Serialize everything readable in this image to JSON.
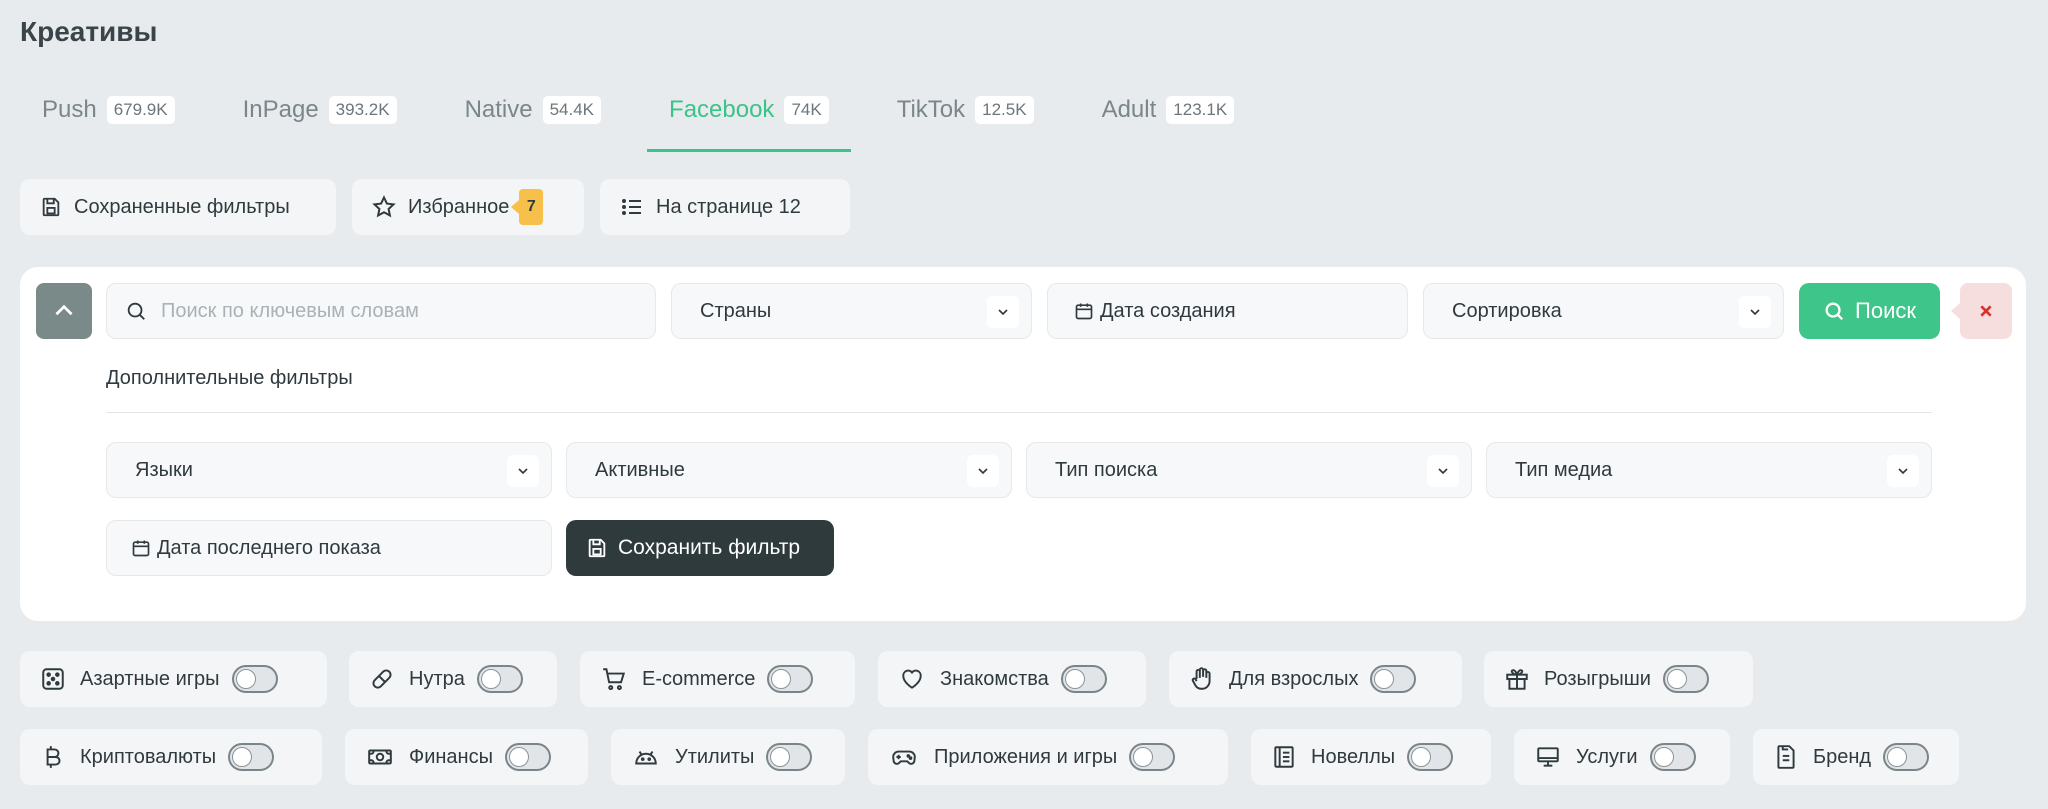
{
  "page": {
    "title": "Креативы"
  },
  "tabs": [
    {
      "label": "Push",
      "count": "679.9K"
    },
    {
      "label": "InPage",
      "count": "393.2K"
    },
    {
      "label": "Native",
      "count": "54.4K"
    },
    {
      "label": "Facebook",
      "count": "74K",
      "active": true
    },
    {
      "label": "TikTok",
      "count": "12.5K"
    },
    {
      "label": "Adult",
      "count": "123.1K"
    }
  ],
  "toolbar": {
    "saved_filters": "Сохраненные фильтры",
    "favorites": "Избранное",
    "favorites_count": "7",
    "per_page": "На странице 12"
  },
  "filters": {
    "search_placeholder": "Поиск по ключевым словам",
    "search_value": "",
    "countries": "Страны",
    "created_date": "Дата создания",
    "sort": "Сортировка",
    "search_button": "Поиск",
    "extra_title": "Дополнительные фильтры",
    "languages": "Языки",
    "active": "Активные",
    "search_type": "Тип поиска",
    "media_type": "Тип медиа",
    "last_shown_date": "Дата последнего показа",
    "save_filter": "Сохранить фильтр"
  },
  "categories": [
    {
      "label": "Азартные игры",
      "icon": "dice-icon",
      "enabled": false
    },
    {
      "label": "Нутра",
      "icon": "pill-icon",
      "enabled": false
    },
    {
      "label": "E-commerce",
      "icon": "cart-icon",
      "enabled": false
    },
    {
      "label": "Знакомства",
      "icon": "heart-icon",
      "enabled": false
    },
    {
      "label": "Для взрослых",
      "icon": "hand-icon",
      "enabled": false
    },
    {
      "label": "Розыгрыши",
      "icon": "gift-icon",
      "enabled": false
    },
    {
      "label": "Криптовалюты",
      "icon": "bitcoin-icon",
      "enabled": false
    },
    {
      "label": "Финансы",
      "icon": "cash-icon",
      "enabled": false
    },
    {
      "label": "Утилиты",
      "icon": "android-icon",
      "enabled": false
    },
    {
      "label": "Приложения и игры",
      "icon": "gamepad-icon",
      "enabled": false
    },
    {
      "label": "Новеллы",
      "icon": "book-icon",
      "enabled": false
    },
    {
      "label": "Услуги",
      "icon": "monitor-icon",
      "enabled": false
    },
    {
      "label": "Бренд",
      "icon": "document-icon",
      "enabled": false
    }
  ],
  "colors": {
    "accent": "#3cc388",
    "background": "#e8ebee",
    "dark_button": "#2f3a3d",
    "badge": "#f7c04a",
    "clear_bg": "#f7dede",
    "clear_x": "#d9312b"
  }
}
